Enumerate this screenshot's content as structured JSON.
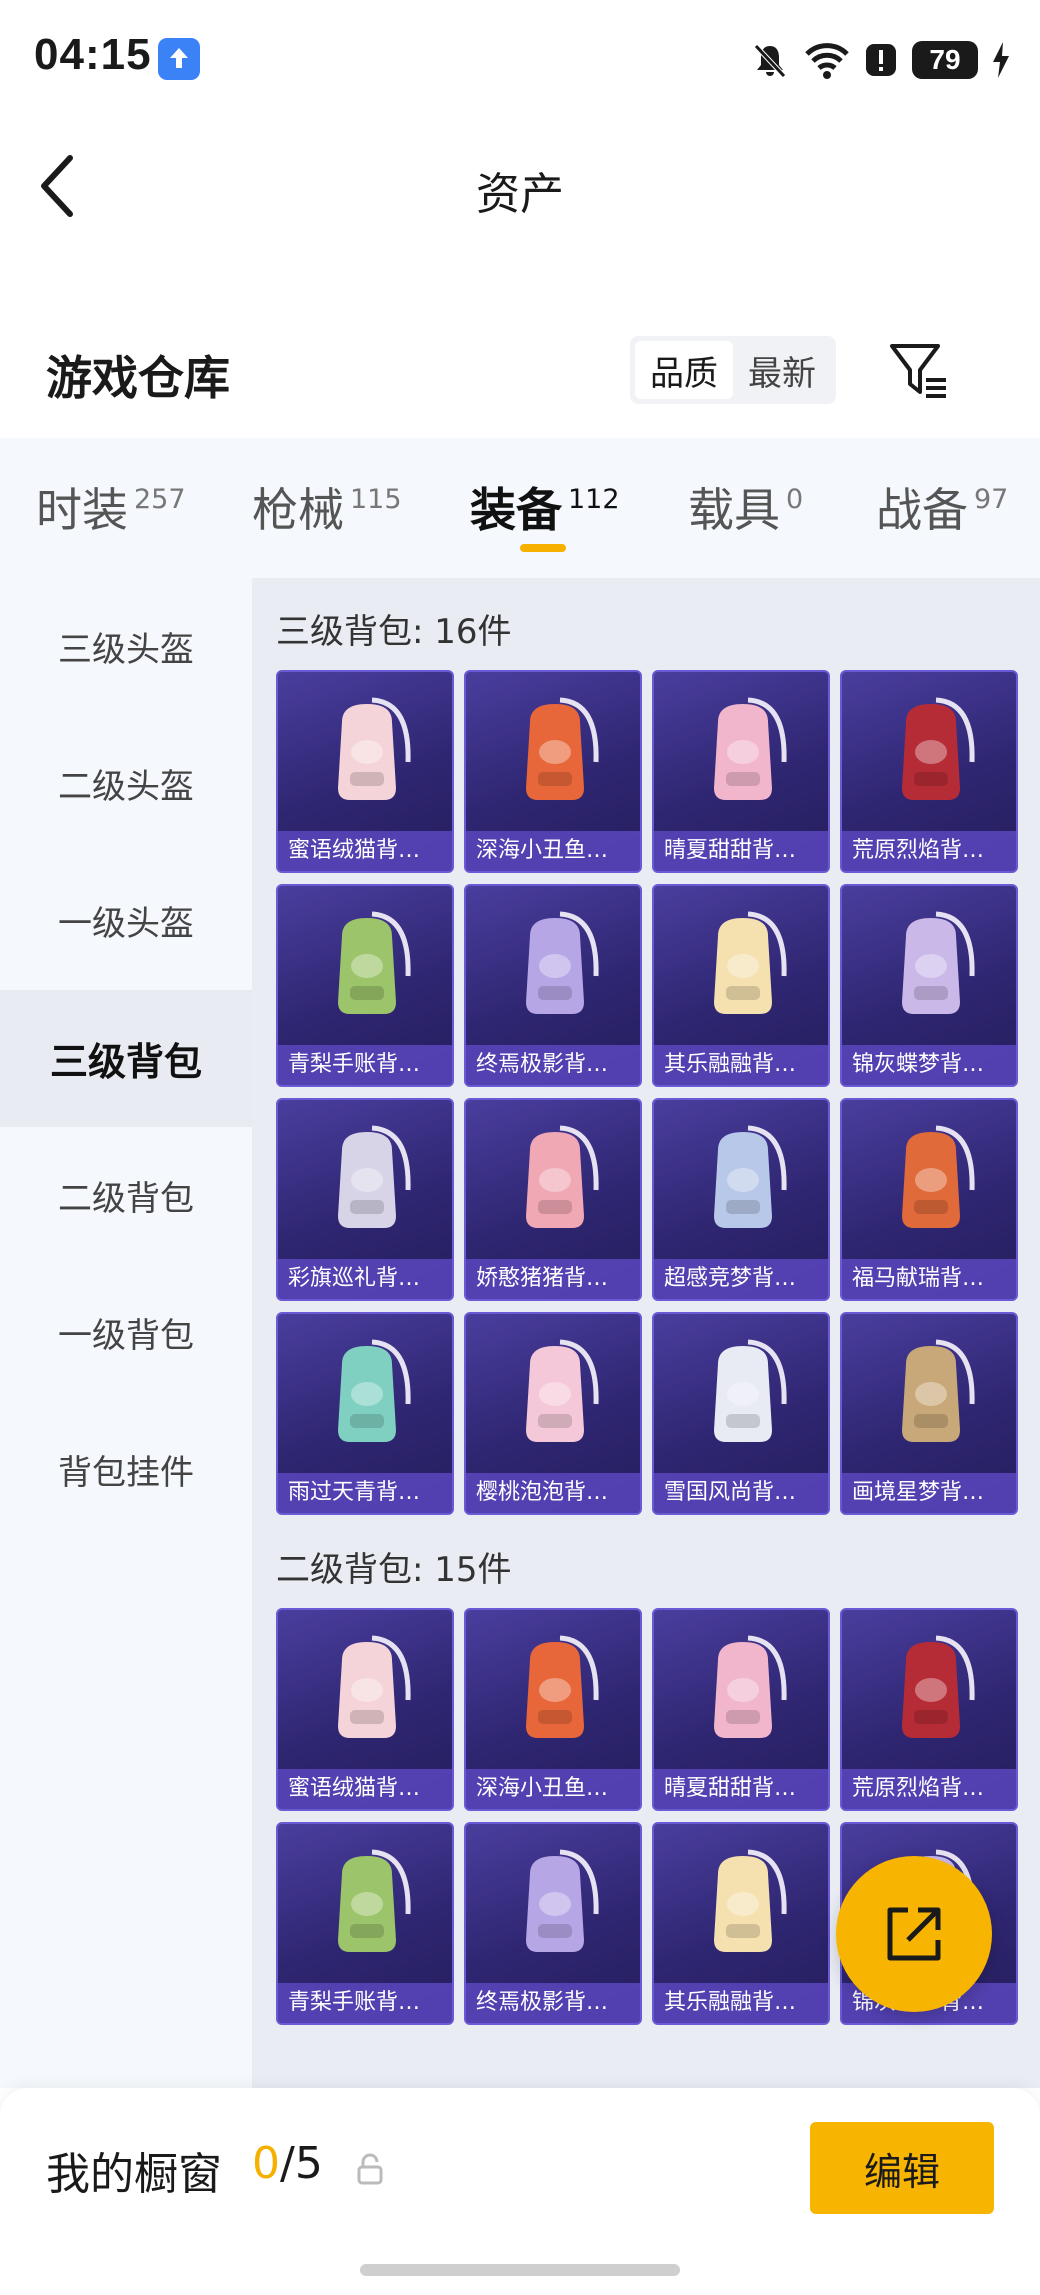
{
  "status_bar": {
    "time": "04:15",
    "battery": "79"
  },
  "header": {
    "title": "资产"
  },
  "warehouse": {
    "title": "游戏仓库",
    "sort_options": [
      "品质",
      "最新"
    ],
    "sort_selected": "品质"
  },
  "tabs": [
    {
      "label": "时装",
      "count": "257"
    },
    {
      "label": "枪械",
      "count": "115"
    },
    {
      "label": "装备",
      "count": "112",
      "active": true
    },
    {
      "label": "载具",
      "count": "0"
    },
    {
      "label": "战备",
      "count": "97"
    }
  ],
  "categories": [
    "三级头盔",
    "二级头盔",
    "一级头盔",
    "三级背包",
    "二级背包",
    "一级背包",
    "背包挂件"
  ],
  "active_category": "三级背包",
  "sections": [
    {
      "title": "三级背包: 16件",
      "items": [
        "蜜语绒猫背…",
        "深海小丑鱼…",
        "晴夏甜甜背…",
        "荒原烈焰背…",
        "青梨手账背…",
        "终焉极影背…",
        "其乐融融背…",
        "锦灰蝶梦背…",
        "彩旗巡礼背…",
        "娇憨猪猪背…",
        "超感竞梦背…",
        "福马献瑞背…",
        "雨过天青背…",
        "樱桃泡泡背…",
        "雪国风尚背…",
        "画境星梦背…"
      ]
    },
    {
      "title": "二级背包: 15件",
      "items": [
        "蜜语绒猫背…",
        "深海小丑鱼…",
        "晴夏甜甜背…",
        "荒原烈焰背…",
        "青梨手账背…",
        "终焉极影背…",
        "其乐融融背…",
        "锦灰蝶梦背…"
      ]
    }
  ],
  "showcase": {
    "label": "我的橱窗",
    "current": "0",
    "total": "/5"
  },
  "edit_button": "编辑",
  "colors": {
    "accent": "#f7b400",
    "card_bg": "#2f2672",
    "card_label": "#5a46be"
  }
}
